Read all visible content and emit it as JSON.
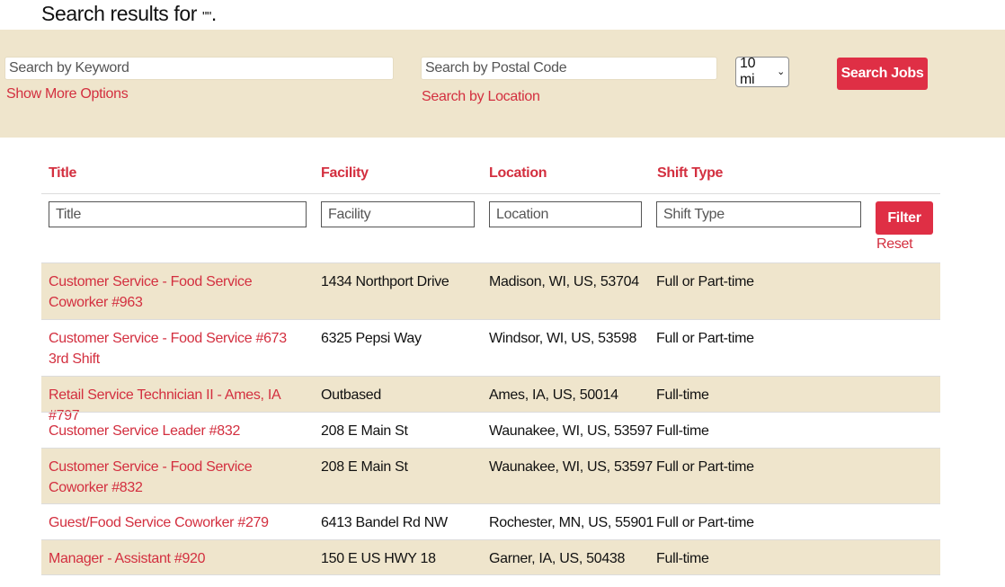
{
  "heading": {
    "prefix": "Search results for ",
    "query": "\"\"",
    "suffix": "."
  },
  "search": {
    "keyword_placeholder": "Search by Keyword",
    "keyword_value": "",
    "show_more_options": "Show More Options",
    "postal_placeholder": "Search by Postal Code",
    "postal_value": "",
    "search_by_location": "Search by Location",
    "radius": "10 mi",
    "search_button": "Search Jobs"
  },
  "table": {
    "columns": [
      "Title",
      "Facility",
      "Location",
      "Shift Type"
    ],
    "filter_placeholders": [
      "Title",
      "Facility",
      "Location",
      "Shift Type"
    ],
    "filter_button": "Filter",
    "reset": "Reset",
    "rows": [
      {
        "title": "Customer Service - Food Service Coworker #963",
        "facility": "1434 Northport Drive",
        "location": "Madison, WI, US, 53704",
        "shift": "Full or Part-time"
      },
      {
        "title": "Customer Service - Food Service #673 3rd Shift",
        "facility": "6325 Pepsi Way",
        "location": "Windsor, WI, US, 53598",
        "shift": "Full or Part-time"
      },
      {
        "title": "Retail Service Technician II - Ames, IA #797",
        "facility": "Outbased",
        "location": "Ames, IA, US, 50014",
        "shift": "Full-time"
      },
      {
        "title": "Customer Service Leader #832",
        "facility": "208 E Main St",
        "location": "Waunakee, WI, US, 53597",
        "shift": "Full-time"
      },
      {
        "title": "Customer Service - Food Service Coworker #832",
        "facility": "208 E Main St",
        "location": "Waunakee, WI, US, 53597",
        "shift": "Full or Part-time"
      },
      {
        "title": "Guest/Food Service Coworker #279",
        "facility": "6413 Bandel Rd NW",
        "location": "Rochester, MN, US, 55901",
        "shift": "Full or Part-time"
      },
      {
        "title": "Manager - Assistant #920",
        "facility": "150 E US HWY 18",
        "location": "Garner, IA, US, 50438",
        "shift": "Full-time"
      }
    ]
  },
  "colors": {
    "accent": "#d32f3f",
    "button": "#df2f45",
    "band": "#efe5cc"
  }
}
